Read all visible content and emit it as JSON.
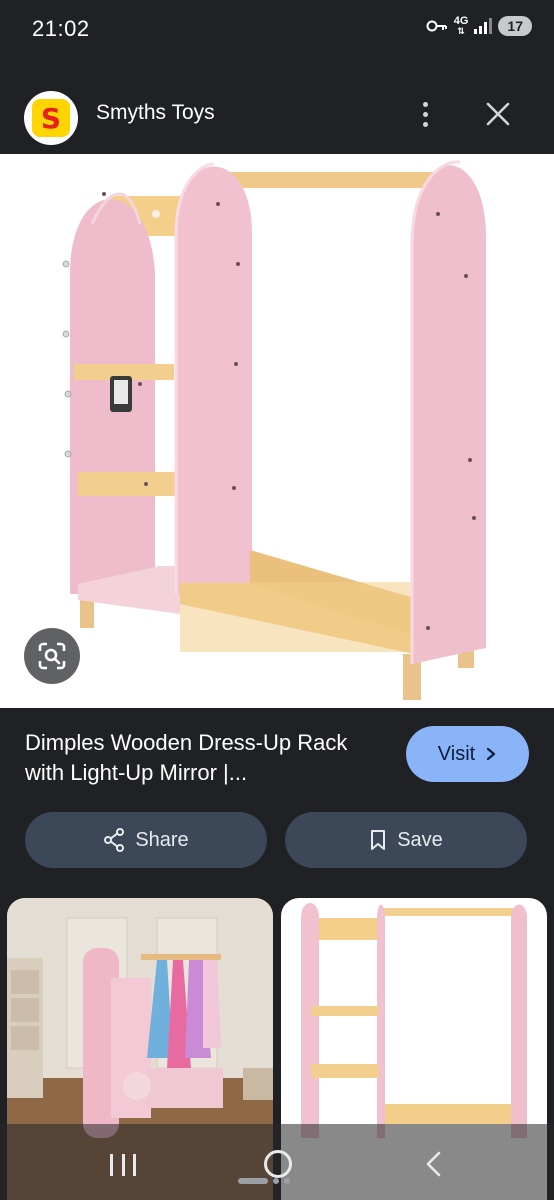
{
  "status_bar": {
    "time": "21:02",
    "network": "4G",
    "battery": "17",
    "icons": [
      "key-icon",
      "signal-icon"
    ]
  },
  "header": {
    "logo_letter": "S",
    "site_name": "Smyths Toys",
    "icons": [
      "more-vert-icon",
      "close-icon"
    ]
  },
  "result": {
    "title": "Dimples Wooden Dress-Up Rack with Light-Up Mirror |...",
    "visit_label": "Visit",
    "share_label": "Share",
    "save_label": "Save"
  },
  "colors": {
    "accent": "#8ab4f8",
    "button_bg": "#3c4758",
    "background": "#1f2124",
    "logo_yellow": "#ffd400",
    "logo_red": "#e2231a",
    "rack_pink": "#f2c8d3",
    "rack_wood": "#f2cf8e"
  }
}
